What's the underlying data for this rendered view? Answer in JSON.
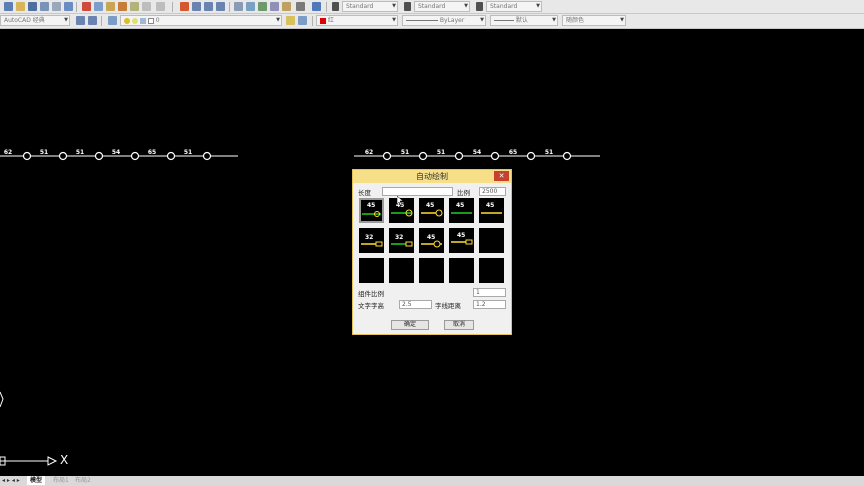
{
  "toolbar1": {
    "text_style": "Standard",
    "dim_style": "Standard",
    "table_style": "Standard"
  },
  "toolbar2": {
    "workspace": "AutoCAD 经典",
    "layer": "0",
    "color": "红",
    "linetype": "ByLayer",
    "lineweight": "默认",
    "plot_style": "随颜色"
  },
  "drawing": {
    "left_labels": [
      "62",
      "51",
      "51",
      "54",
      "65",
      "51"
    ],
    "right_labels": [
      "62",
      "51",
      "51",
      "54",
      "65",
      "51"
    ],
    "ucs_x": "X"
  },
  "dialog": {
    "title": "自动绘制",
    "close_glyph": "✕",
    "length_label": "长度",
    "length_value": "",
    "scale_label": "比例",
    "scale_value": "2500",
    "tile_labels": [
      "45",
      "45",
      "45",
      "45",
      "45",
      "32",
      "32",
      "45",
      "45"
    ],
    "component_scale_label": "组件比例",
    "component_scale_value": "1",
    "text_height_label": "文字字高",
    "text_height_value": "2.5",
    "text_line_gap_label": "字线距离",
    "text_line_gap_value": "1.2",
    "ok_label": "确定",
    "cancel_label": "取消"
  },
  "bottom_tabs": {
    "model": "模型",
    "layout1": "布局1",
    "layout2": "布局2"
  }
}
